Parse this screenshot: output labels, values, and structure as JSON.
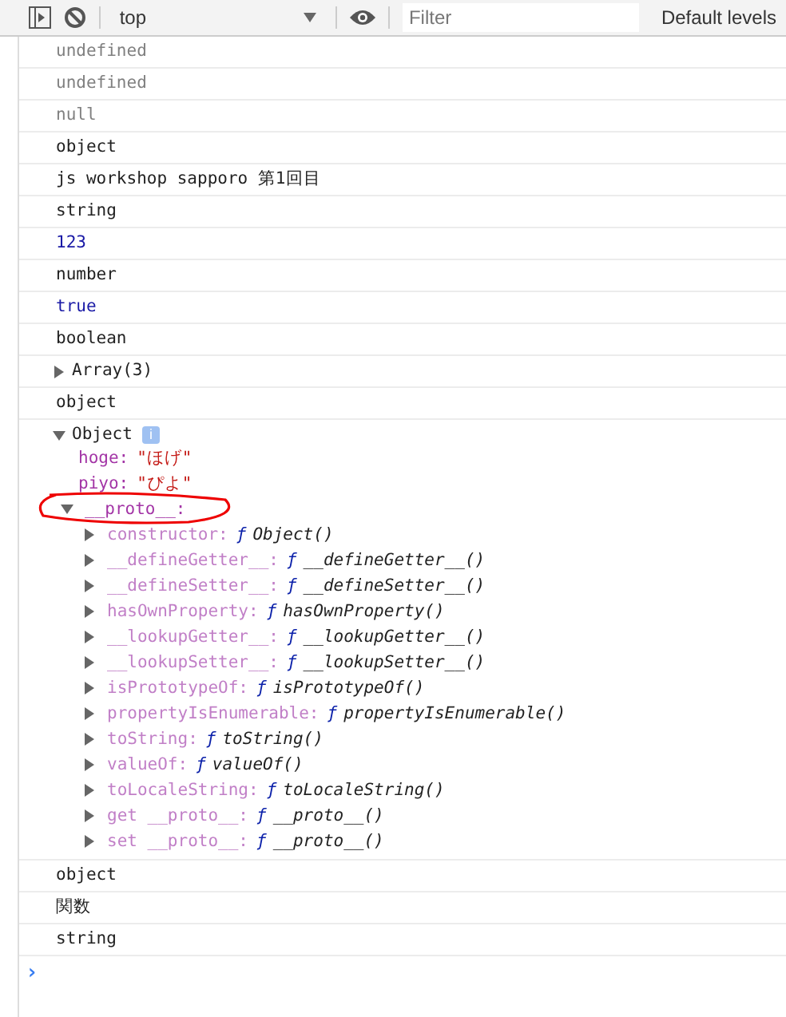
{
  "toolbar": {
    "context": "top",
    "filter_placeholder": "Filter",
    "levels": "Default levels"
  },
  "messages": [
    {
      "kind": "undefined",
      "text": "undefined"
    },
    {
      "kind": "undefined",
      "text": "undefined"
    },
    {
      "kind": "undefined",
      "text": "null"
    },
    {
      "kind": "plain",
      "text": "object"
    },
    {
      "kind": "plain",
      "text": "js workshop sapporo 第1回目"
    },
    {
      "kind": "plain",
      "text": "string"
    },
    {
      "kind": "number",
      "text": "123"
    },
    {
      "kind": "plain",
      "text": "number"
    },
    {
      "kind": "number",
      "text": "true"
    },
    {
      "kind": "plain",
      "text": "boolean"
    },
    {
      "kind": "tree",
      "text": "Array(3)",
      "expanded": false
    },
    {
      "kind": "plain",
      "text": "object"
    },
    {
      "kind": "tree",
      "text": "Object",
      "expanded": true,
      "badge": "i",
      "children": [
        {
          "key": "hoge:",
          "value": "\"ほげ\"",
          "kind": "string"
        },
        {
          "key": "piyo:",
          "value": "\"ぴよ\"",
          "kind": "string"
        },
        {
          "key": "__proto__:",
          "kind": "proto",
          "expanded": true,
          "circled": true,
          "children": [
            {
              "key": "constructor:",
              "sign": "ƒ",
              "value": "Object()",
              "expanded": false
            },
            {
              "key": "__defineGetter__:",
              "sign": "ƒ",
              "value": "__defineGetter__()",
              "expanded": false
            },
            {
              "key": "__defineSetter__:",
              "sign": "ƒ",
              "value": "__defineSetter__()",
              "expanded": false
            },
            {
              "key": "hasOwnProperty:",
              "sign": "ƒ",
              "value": "hasOwnProperty()",
              "expanded": false
            },
            {
              "key": "__lookupGetter__:",
              "sign": "ƒ",
              "value": "__lookupGetter__()",
              "expanded": false
            },
            {
              "key": "__lookupSetter__:",
              "sign": "ƒ",
              "value": "__lookupSetter__()",
              "expanded": false
            },
            {
              "key": "isPrototypeOf:",
              "sign": "ƒ",
              "value": "isPrototypeOf()",
              "expanded": false
            },
            {
              "key": "propertyIsEnumerable:",
              "sign": "ƒ",
              "value": "propertyIsEnumerable()",
              "expanded": false
            },
            {
              "key": "toString:",
              "sign": "ƒ",
              "value": "toString()",
              "expanded": false
            },
            {
              "key": "valueOf:",
              "sign": "ƒ",
              "value": "valueOf()",
              "expanded": false
            },
            {
              "key": "toLocaleString:",
              "sign": "ƒ",
              "value": "toLocaleString()",
              "expanded": false
            },
            {
              "key": "get __proto__:",
              "sign": "ƒ",
              "value": "__proto__()",
              "expanded": false
            },
            {
              "key": "set __proto__:",
              "sign": "ƒ",
              "value": "__proto__()",
              "expanded": false
            }
          ]
        }
      ]
    },
    {
      "kind": "plain",
      "text": "object"
    },
    {
      "kind": "plain",
      "text": "関数"
    },
    {
      "kind": "plain",
      "text": "string"
    }
  ],
  "prompt": "›"
}
